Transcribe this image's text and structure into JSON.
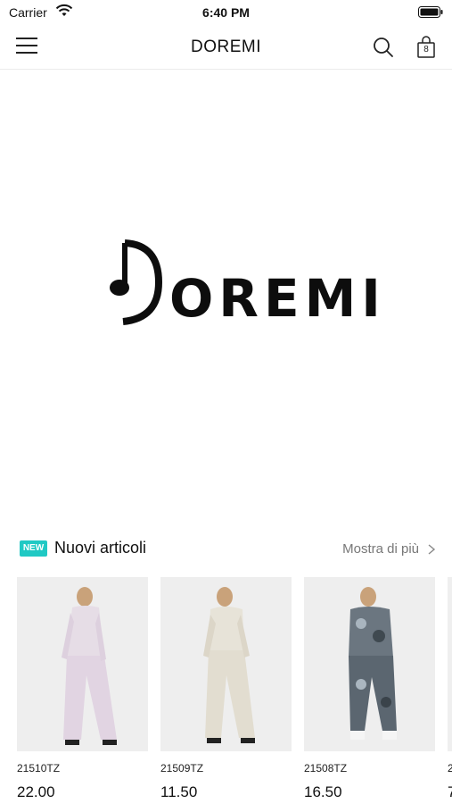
{
  "status_bar": {
    "carrier": "Carrier",
    "time": "6:40 PM",
    "icons": [
      "wifi-icon",
      "battery-icon"
    ]
  },
  "nav": {
    "title": "DOREMI",
    "menu_icon": "hamburger-menu-icon",
    "search_icon": "search-icon",
    "cart_icon": "shopping-bag-icon",
    "cart_count": "8"
  },
  "hero": {
    "logo_text": "OREMI",
    "logo_mark": "music-note-d-logo"
  },
  "section": {
    "badge": "NEW",
    "title": "Nuovi articoli",
    "more_label": "Mostra di più",
    "badge_color": "#20c9c4"
  },
  "products": [
    {
      "code": "21510TZ",
      "price": "22.00",
      "outfit_color": "#e6dde6"
    },
    {
      "code": "21509TZ",
      "price": "11.50",
      "outfit_color": "#e7e3d8"
    },
    {
      "code": "21508TZ",
      "price": "16.50",
      "outfit_color": "#6b7680"
    }
  ],
  "peek_product": {
    "code": "2",
    "price": "7"
  }
}
